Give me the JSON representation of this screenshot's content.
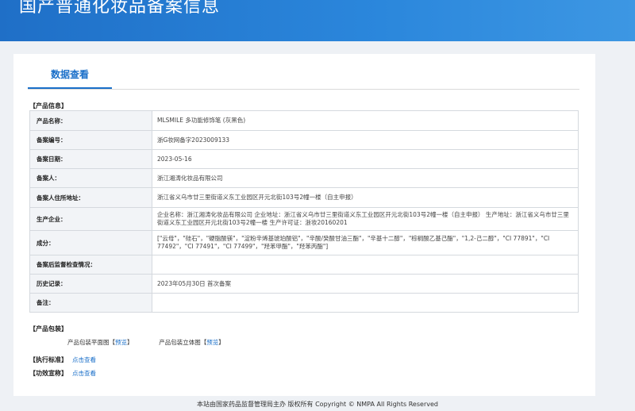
{
  "header": {
    "title": "国产普通化妆品备案信息"
  },
  "tab": {
    "label": "数据查看"
  },
  "product_info": {
    "section_title": "【产品信息】",
    "rows": [
      {
        "label": "产品名称：",
        "value": "MLSMILE 多功能修饰笔 (灰黑色)"
      },
      {
        "label": "备案编号：",
        "value": "浙G妆网备字2023009133"
      },
      {
        "label": "备案日期：",
        "value": "2023-05-16"
      },
      {
        "label": "备案人：",
        "value": "浙江湘涛化妆品有限公司"
      },
      {
        "label": "备案人住所地址：",
        "value": "浙江省义乌市廿三里街道义东工业园区开元北街103号2幢一楼（自主申报）"
      },
      {
        "label": "生产企业：",
        "value": "企业名称：浙江湘涛化妆品有限公司 企业地址：浙江省义乌市廿三里街道义东工业园区开元北街103号2幢一楼（自主申报） 生产地址：浙江省义乌市廿三里街道义东工业园区开元北街103号2幢一楼 生产许可证：浙妆20160201"
      },
      {
        "label": "成分：",
        "value": "[\"云母\"，\"硅石\"，\"硬脂酸镁\"，\"淀粉辛烯基琥珀酸铝\"，\"辛酸/癸酸甘油三酯\"，\"辛基十二醇\"，\"棕榈酸乙基己酯\"，\"1,2-己二醇\"，\"CI 77891\"，\"CI 77492\"，\"CI 77491\"，\"CI 77499\"，\"羟苯甲酯\"，\"羟苯丙酯\"]"
      },
      {
        "label": "备案后监督检查情况：",
        "value": ""
      },
      {
        "label": "历史记录：",
        "value": "2023年05月30日 首次备案"
      },
      {
        "label": "备注：",
        "value": ""
      }
    ]
  },
  "packaging": {
    "section_title": "【产品包装】",
    "flat_label": "产品包装平面图",
    "flat_link": "预览",
    "solid_label": "产品包装立体图",
    "solid_link": "预览",
    "bracket_open": "【",
    "bracket_close": "】"
  },
  "standard": {
    "section_title": "【执行标准】",
    "link": "点击查看"
  },
  "efficacy": {
    "section_title": "【功效宣称】",
    "link": "点击查看"
  },
  "footer": {
    "text": "本站由国家药品监督管理局主办 版权所有 Copyright © NMPA All Rights Reserved"
  }
}
